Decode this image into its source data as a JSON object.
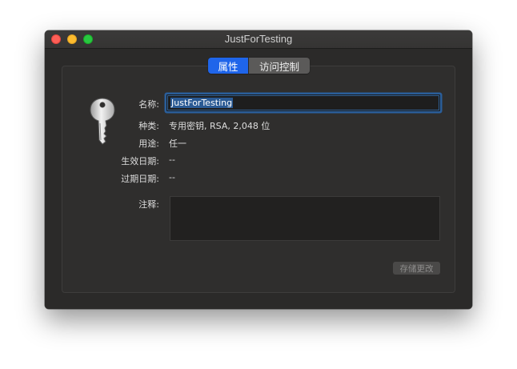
{
  "window": {
    "title": "JustForTesting"
  },
  "tabs": [
    {
      "label": "属性",
      "active": true
    },
    {
      "label": "访问控制",
      "active": false
    }
  ],
  "fields": {
    "name": {
      "label": "名称:",
      "value": "JustForTesting"
    },
    "kind": {
      "label": "种类:",
      "value": "专用密钥, RSA, 2,048 位"
    },
    "usage": {
      "label": "用途:",
      "value": "任一"
    },
    "start": {
      "label": "生效日期:",
      "value": "--"
    },
    "expire": {
      "label": "过期日期:",
      "value": "--"
    },
    "comment": {
      "label": "注释:",
      "value": ""
    }
  },
  "actions": {
    "save_label": "存储更改"
  },
  "icon": "key-icon",
  "colors": {
    "accent": "#1f65ea",
    "window_bg": "#2b2a29",
    "focus_ring": "#2a5e9a"
  }
}
